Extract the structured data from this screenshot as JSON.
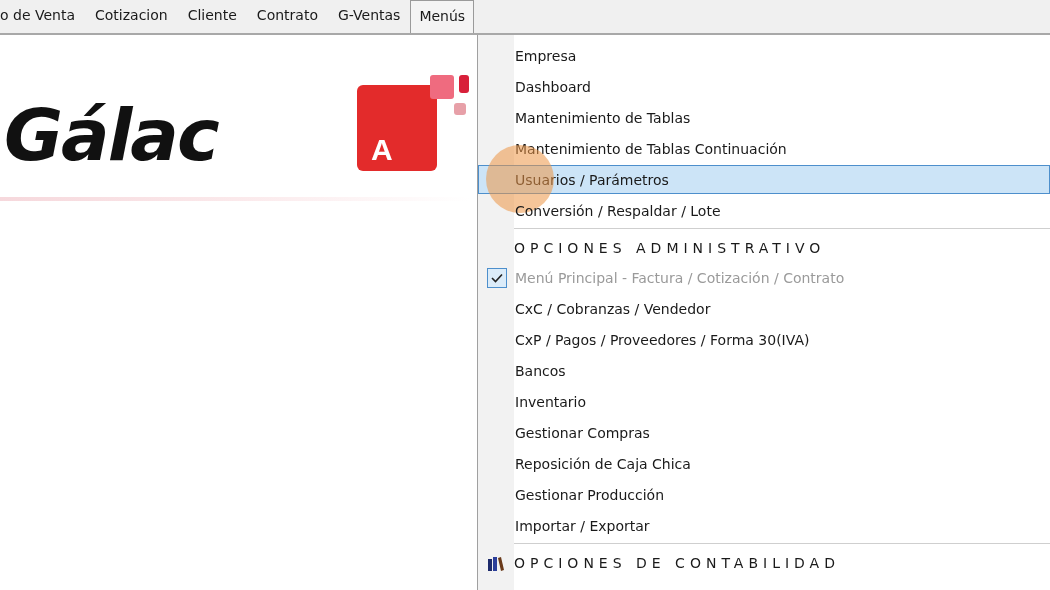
{
  "menu_bar": [
    {
      "label": "o de Venta",
      "selected": false
    },
    {
      "label": "Cotizacion",
      "selected": false
    },
    {
      "label": "Cliente",
      "selected": false
    },
    {
      "label": "Contrato",
      "selected": false
    },
    {
      "label": "G-Ventas",
      "selected": false
    },
    {
      "label": "Menús",
      "selected": true
    }
  ],
  "logo": {
    "text": "Gálac",
    "app_icon_letter": "A"
  },
  "dropdown": {
    "items": [
      {
        "kind": "item",
        "label": "Empresa",
        "selected": false,
        "checked": false,
        "disabled": false
      },
      {
        "kind": "item",
        "label": "Dashboard",
        "selected": false,
        "checked": false,
        "disabled": false
      },
      {
        "kind": "item",
        "label": "Mantenimiento de Tablas",
        "selected": false,
        "checked": false,
        "disabled": false
      },
      {
        "kind": "item",
        "label": "Mantenimiento de Tablas Continuación",
        "selected": false,
        "checked": false,
        "disabled": false
      },
      {
        "kind": "item",
        "label": "Usuarios / Parámetros",
        "selected": true,
        "checked": false,
        "disabled": false
      },
      {
        "kind": "item",
        "label": "Conversión / Respaldar / Lote",
        "selected": false,
        "checked": false,
        "disabled": false
      },
      {
        "kind": "header",
        "label": "OPCIONES ADMINISTRATIVO",
        "icon": false
      },
      {
        "kind": "item",
        "label": "Menú Principal - Factura / Cotización / Contrato",
        "selected": false,
        "checked": true,
        "disabled": true
      },
      {
        "kind": "item",
        "label": "CxC / Cobranzas / Vendedor",
        "selected": false,
        "checked": false,
        "disabled": false
      },
      {
        "kind": "item",
        "label": "CxP / Pagos / Proveedores / Forma 30(IVA)",
        "selected": false,
        "checked": false,
        "disabled": false
      },
      {
        "kind": "item",
        "label": "Bancos",
        "selected": false,
        "checked": false,
        "disabled": false
      },
      {
        "kind": "item",
        "label": "Inventario",
        "selected": false,
        "checked": false,
        "disabled": false
      },
      {
        "kind": "item",
        "label": "Gestionar Compras",
        "selected": false,
        "checked": false,
        "disabled": false
      },
      {
        "kind": "item",
        "label": "Reposición de Caja Chica",
        "selected": false,
        "checked": false,
        "disabled": false
      },
      {
        "kind": "item",
        "label": "Gestionar Producción",
        "selected": false,
        "checked": false,
        "disabled": false
      },
      {
        "kind": "item",
        "label": "Importar / Exportar",
        "selected": false,
        "checked": false,
        "disabled": false
      },
      {
        "kind": "header",
        "label": "OPCIONES DE CONTABILIDAD",
        "icon": true
      }
    ]
  }
}
